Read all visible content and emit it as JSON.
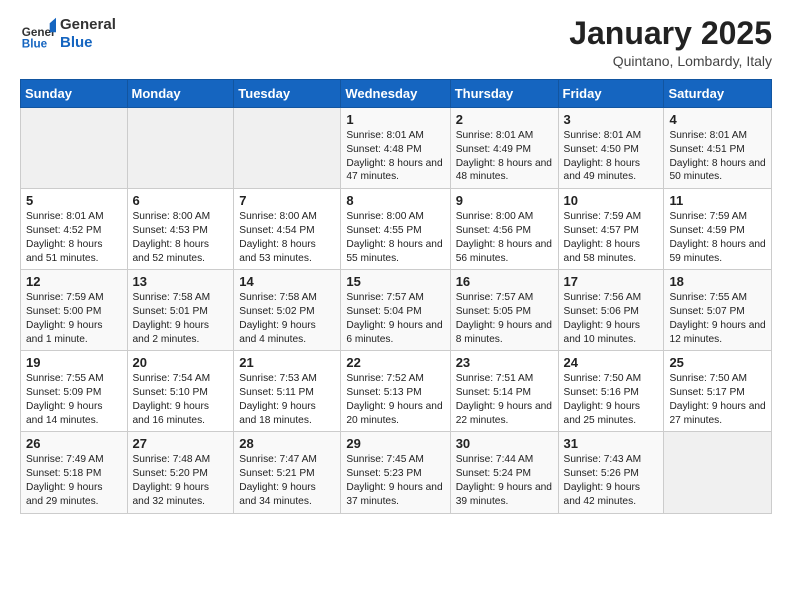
{
  "header": {
    "logo_general": "General",
    "logo_blue": "Blue",
    "month_title": "January 2025",
    "location": "Quintano, Lombardy, Italy"
  },
  "weekdays": [
    "Sunday",
    "Monday",
    "Tuesday",
    "Wednesday",
    "Thursday",
    "Friday",
    "Saturday"
  ],
  "weeks": [
    [
      {
        "day": "",
        "empty": true
      },
      {
        "day": "",
        "empty": true
      },
      {
        "day": "",
        "empty": true
      },
      {
        "day": "1",
        "sunrise": "8:01 AM",
        "sunset": "4:48 PM",
        "daylight": "8 hours and 47 minutes."
      },
      {
        "day": "2",
        "sunrise": "8:01 AM",
        "sunset": "4:49 PM",
        "daylight": "8 hours and 48 minutes."
      },
      {
        "day": "3",
        "sunrise": "8:01 AM",
        "sunset": "4:50 PM",
        "daylight": "8 hours and 49 minutes."
      },
      {
        "day": "4",
        "sunrise": "8:01 AM",
        "sunset": "4:51 PM",
        "daylight": "8 hours and 50 minutes."
      }
    ],
    [
      {
        "day": "5",
        "sunrise": "8:01 AM",
        "sunset": "4:52 PM",
        "daylight": "8 hours and 51 minutes."
      },
      {
        "day": "6",
        "sunrise": "8:00 AM",
        "sunset": "4:53 PM",
        "daylight": "8 hours and 52 minutes."
      },
      {
        "day": "7",
        "sunrise": "8:00 AM",
        "sunset": "4:54 PM",
        "daylight": "8 hours and 53 minutes."
      },
      {
        "day": "8",
        "sunrise": "8:00 AM",
        "sunset": "4:55 PM",
        "daylight": "8 hours and 55 minutes."
      },
      {
        "day": "9",
        "sunrise": "8:00 AM",
        "sunset": "4:56 PM",
        "daylight": "8 hours and 56 minutes."
      },
      {
        "day": "10",
        "sunrise": "7:59 AM",
        "sunset": "4:57 PM",
        "daylight": "8 hours and 58 minutes."
      },
      {
        "day": "11",
        "sunrise": "7:59 AM",
        "sunset": "4:59 PM",
        "daylight": "8 hours and 59 minutes."
      }
    ],
    [
      {
        "day": "12",
        "sunrise": "7:59 AM",
        "sunset": "5:00 PM",
        "daylight": "9 hours and 1 minute."
      },
      {
        "day": "13",
        "sunrise": "7:58 AM",
        "sunset": "5:01 PM",
        "daylight": "9 hours and 2 minutes."
      },
      {
        "day": "14",
        "sunrise": "7:58 AM",
        "sunset": "5:02 PM",
        "daylight": "9 hours and 4 minutes."
      },
      {
        "day": "15",
        "sunrise": "7:57 AM",
        "sunset": "5:04 PM",
        "daylight": "9 hours and 6 minutes."
      },
      {
        "day": "16",
        "sunrise": "7:57 AM",
        "sunset": "5:05 PM",
        "daylight": "9 hours and 8 minutes."
      },
      {
        "day": "17",
        "sunrise": "7:56 AM",
        "sunset": "5:06 PM",
        "daylight": "9 hours and 10 minutes."
      },
      {
        "day": "18",
        "sunrise": "7:55 AM",
        "sunset": "5:07 PM",
        "daylight": "9 hours and 12 minutes."
      }
    ],
    [
      {
        "day": "19",
        "sunrise": "7:55 AM",
        "sunset": "5:09 PM",
        "daylight": "9 hours and 14 minutes."
      },
      {
        "day": "20",
        "sunrise": "7:54 AM",
        "sunset": "5:10 PM",
        "daylight": "9 hours and 16 minutes."
      },
      {
        "day": "21",
        "sunrise": "7:53 AM",
        "sunset": "5:11 PM",
        "daylight": "9 hours and 18 minutes."
      },
      {
        "day": "22",
        "sunrise": "7:52 AM",
        "sunset": "5:13 PM",
        "daylight": "9 hours and 20 minutes."
      },
      {
        "day": "23",
        "sunrise": "7:51 AM",
        "sunset": "5:14 PM",
        "daylight": "9 hours and 22 minutes."
      },
      {
        "day": "24",
        "sunrise": "7:50 AM",
        "sunset": "5:16 PM",
        "daylight": "9 hours and 25 minutes."
      },
      {
        "day": "25",
        "sunrise": "7:50 AM",
        "sunset": "5:17 PM",
        "daylight": "9 hours and 27 minutes."
      }
    ],
    [
      {
        "day": "26",
        "sunrise": "7:49 AM",
        "sunset": "5:18 PM",
        "daylight": "9 hours and 29 minutes."
      },
      {
        "day": "27",
        "sunrise": "7:48 AM",
        "sunset": "5:20 PM",
        "daylight": "9 hours and 32 minutes."
      },
      {
        "day": "28",
        "sunrise": "7:47 AM",
        "sunset": "5:21 PM",
        "daylight": "9 hours and 34 minutes."
      },
      {
        "day": "29",
        "sunrise": "7:45 AM",
        "sunset": "5:23 PM",
        "daylight": "9 hours and 37 minutes."
      },
      {
        "day": "30",
        "sunrise": "7:44 AM",
        "sunset": "5:24 PM",
        "daylight": "9 hours and 39 minutes."
      },
      {
        "day": "31",
        "sunrise": "7:43 AM",
        "sunset": "5:26 PM",
        "daylight": "9 hours and 42 minutes."
      },
      {
        "day": "",
        "empty": true
      }
    ]
  ],
  "labels": {
    "sunrise": "Sunrise:",
    "sunset": "Sunset:",
    "daylight": "Daylight:"
  }
}
